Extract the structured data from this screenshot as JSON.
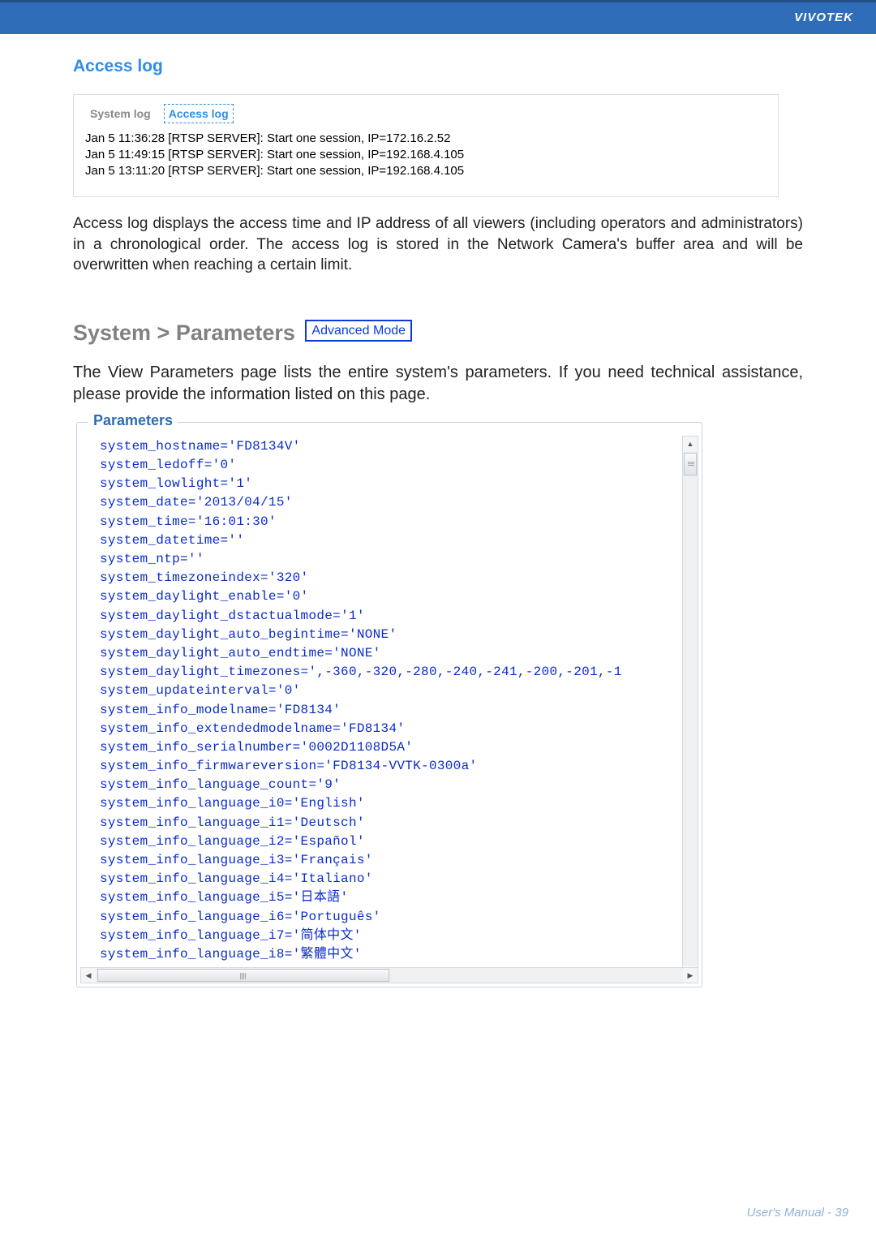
{
  "brand": "VIVOTEK",
  "section_access_log": {
    "heading": "Access log",
    "tabs": {
      "system": "System log",
      "access": "Access log"
    },
    "lines": [
      "Jan 5 11:36:28 [RTSP SERVER]: Start one session, IP=172.16.2.52",
      "Jan 5 11:49:15 [RTSP SERVER]: Start one session, IP=192.168.4.105",
      "Jan 5 13:11:20 [RTSP SERVER]: Start one session, IP=192.168.4.105"
    ],
    "description": "Access log displays the access time and IP address of all viewers (including operators and administrators) in a chronological order. The access log is stored in the Network Camera's buffer area and will be overwritten when reaching a certain limit."
  },
  "section_parameters": {
    "heading": "System > Parameters",
    "badge": "Advanced Mode",
    "description": "The View Parameters page lists the entire system's parameters. If you need technical assistance, please provide the information listed on this page.",
    "legend": "Parameters",
    "lines": [
      "system_hostname='FD8134V'",
      "system_ledoff='0'",
      "system_lowlight='1'",
      "system_date='2013/04/15'",
      "system_time='16:01:30'",
      "system_datetime=''",
      "system_ntp=''",
      "system_timezoneindex='320'",
      "system_daylight_enable='0'",
      "system_daylight_dstactualmode='1'",
      "system_daylight_auto_begintime='NONE'",
      "system_daylight_auto_endtime='NONE'",
      "system_daylight_timezones=',-360,-320,-280,-240,-241,-200,-201,-1",
      "system_updateinterval='0'",
      "system_info_modelname='FD8134'",
      "system_info_extendedmodelname='FD8134'",
      "system_info_serialnumber='0002D1108D5A'",
      "system_info_firmwareversion='FD8134-VVTK-0300a'",
      "system_info_language_count='9'",
      "system_info_language_i0='English'",
      "system_info_language_i1='Deutsch'",
      "system_info_language_i2='Español'",
      "system_info_language_i3='Français'",
      "system_info_language_i4='Italiano'",
      "system_info_language_i5='日本語'",
      "system_info_language_i6='Português'",
      "system_info_language_i7='简体中文'",
      "system_info_language_i8='繁體中文'"
    ]
  },
  "footer": "User's Manual - 39"
}
